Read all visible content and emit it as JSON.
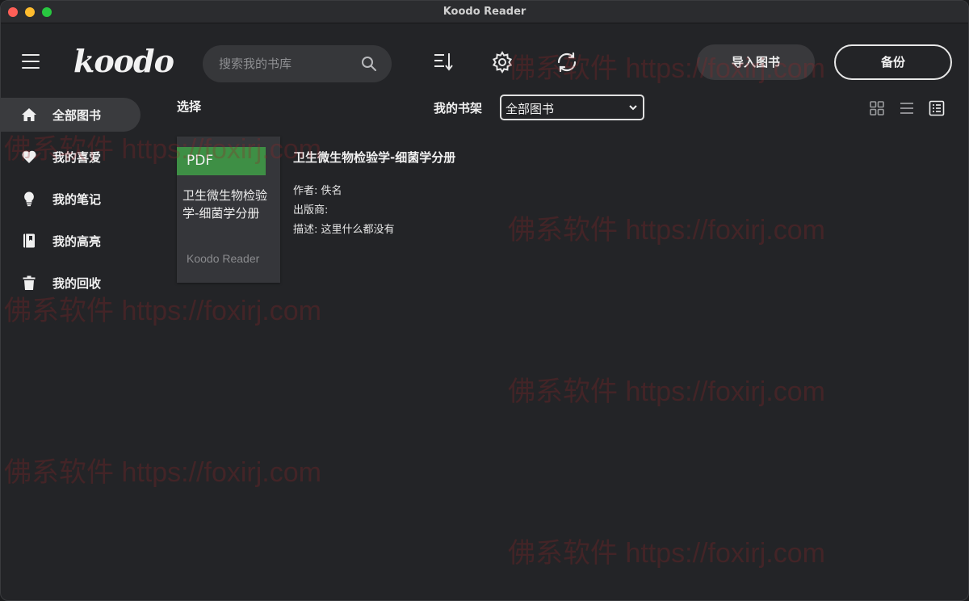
{
  "window": {
    "title": "Koodo Reader"
  },
  "header": {
    "logo": "koodo",
    "search_placeholder": "搜索我的书库",
    "import_label": "导入图书",
    "backup_label": "备份"
  },
  "sidebar": {
    "items": [
      {
        "label": "全部图书",
        "icon": "home-icon",
        "active": true
      },
      {
        "label": "我的喜爱",
        "icon": "heart-icon",
        "active": false
      },
      {
        "label": "我的笔记",
        "icon": "lightbulb-icon",
        "active": false
      },
      {
        "label": "我的高亮",
        "icon": "highlight-book-icon",
        "active": false
      },
      {
        "label": "我的回收",
        "icon": "trash-icon",
        "active": false
      }
    ]
  },
  "toolbar": {
    "select_label": "选择",
    "shelf_label": "我的书架",
    "shelf_value": "全部图书"
  },
  "books": [
    {
      "format": "PDF",
      "cover_title": "卫生微生物检验学-细菌学分册",
      "cover_brand": "Koodo Reader",
      "title": "卫生微生物检验学-细菌学分册",
      "author_line": "作者: 佚名",
      "publisher_line": "出版商:",
      "description_line": "描述: 这里什么都没有"
    }
  ],
  "watermark_text": "佛系软件 https://foxirj.com",
  "colors": {
    "background": "#232427",
    "accent_green": "#3e8f45",
    "active_item": "#3a3b3e"
  }
}
